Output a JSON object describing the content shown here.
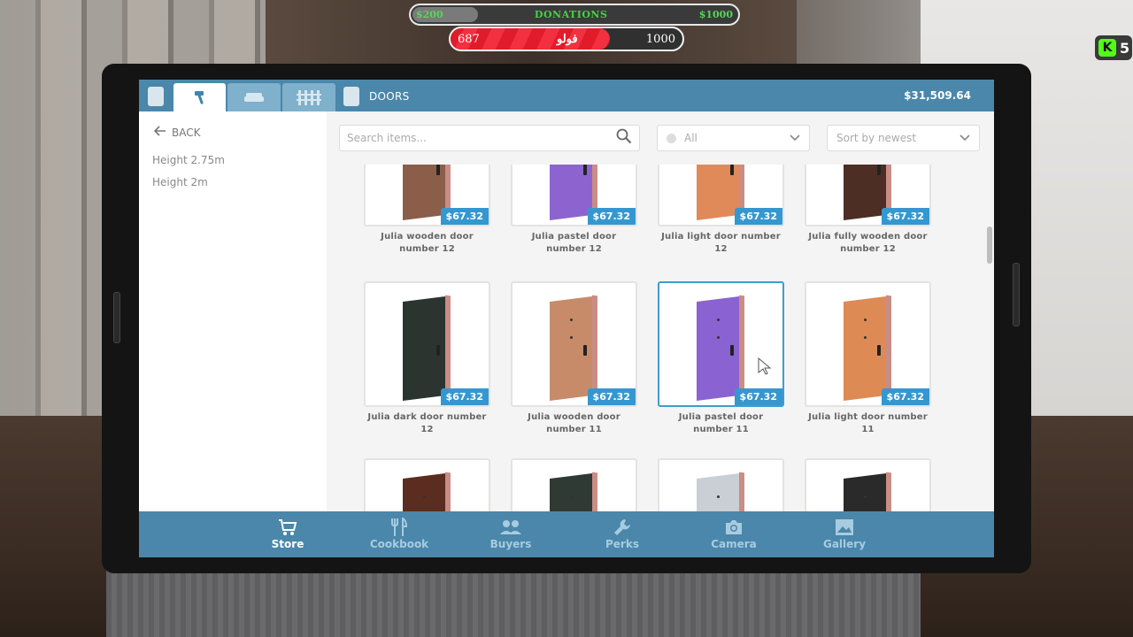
{
  "hud": {
    "donations": {
      "min": "$200",
      "title": "DONATIONS",
      "max": "$1000",
      "fill_fraction": 0.2
    },
    "goal": {
      "current": "687",
      "label": "فولو",
      "target": "1000",
      "fill_fraction": 0.687
    },
    "kick_count": "5"
  },
  "topbar": {
    "tabs": [
      {
        "name": "tools",
        "icon": "hammer-icon",
        "active": true
      },
      {
        "name": "furniture",
        "icon": "sofa-icon",
        "active": false
      },
      {
        "name": "fences",
        "icon": "fence-icon",
        "active": false
      }
    ],
    "section": "DOORS",
    "balance": "$31,509.64"
  },
  "sidebar": {
    "back_label": "BACK",
    "filters": [
      "Height 2.75m",
      "Height 2m"
    ]
  },
  "toolbar": {
    "search_placeholder": "Search items...",
    "category_value": "All",
    "sort_value": "Sort by newest"
  },
  "items": [
    {
      "name": "Julia wooden door number 12",
      "price": "$67.32",
      "color": "#8b5e4a"
    },
    {
      "name": "Julia pastel door number 12",
      "price": "$67.32",
      "color": "#8d64cf"
    },
    {
      "name": "Julia light door number 12",
      "price": "$67.32",
      "color": "#e08a5a"
    },
    {
      "name": "Julia fully wooden door number 12",
      "price": "$67.32",
      "color": "#4c2e25"
    },
    {
      "name": "Julia dark door number 12",
      "price": "$67.32",
      "color": "#2c3430"
    },
    {
      "name": "Julia wooden door number 11",
      "price": "$67.32",
      "color": "#c78b6a"
    },
    {
      "name": "Julia pastel door number 11",
      "price": "$67.32",
      "color": "#8b62d2",
      "selected": true
    },
    {
      "name": "Julia light door number 11",
      "price": "$67.32",
      "color": "#de8a54"
    },
    {
      "name": "",
      "price": "",
      "color": "#5b2c20"
    },
    {
      "name": "",
      "price": "",
      "color": "#2f3a35"
    },
    {
      "name": "",
      "price": "",
      "color": "#c9cfd4"
    },
    {
      "name": "",
      "price": "",
      "color": "#2a2a2a"
    }
  ],
  "bottom_nav": [
    {
      "label": "Store",
      "icon": "store-icon",
      "active": true
    },
    {
      "label": "Cookbook",
      "icon": "cutlery-icon",
      "active": false
    },
    {
      "label": "Buyers",
      "icon": "buyers-icon",
      "active": false
    },
    {
      "label": "Perks",
      "icon": "wrench-icon",
      "active": false
    },
    {
      "label": "Camera",
      "icon": "camera-icon",
      "active": false
    },
    {
      "label": "Gallery",
      "icon": "image-icon",
      "active": false
    }
  ]
}
